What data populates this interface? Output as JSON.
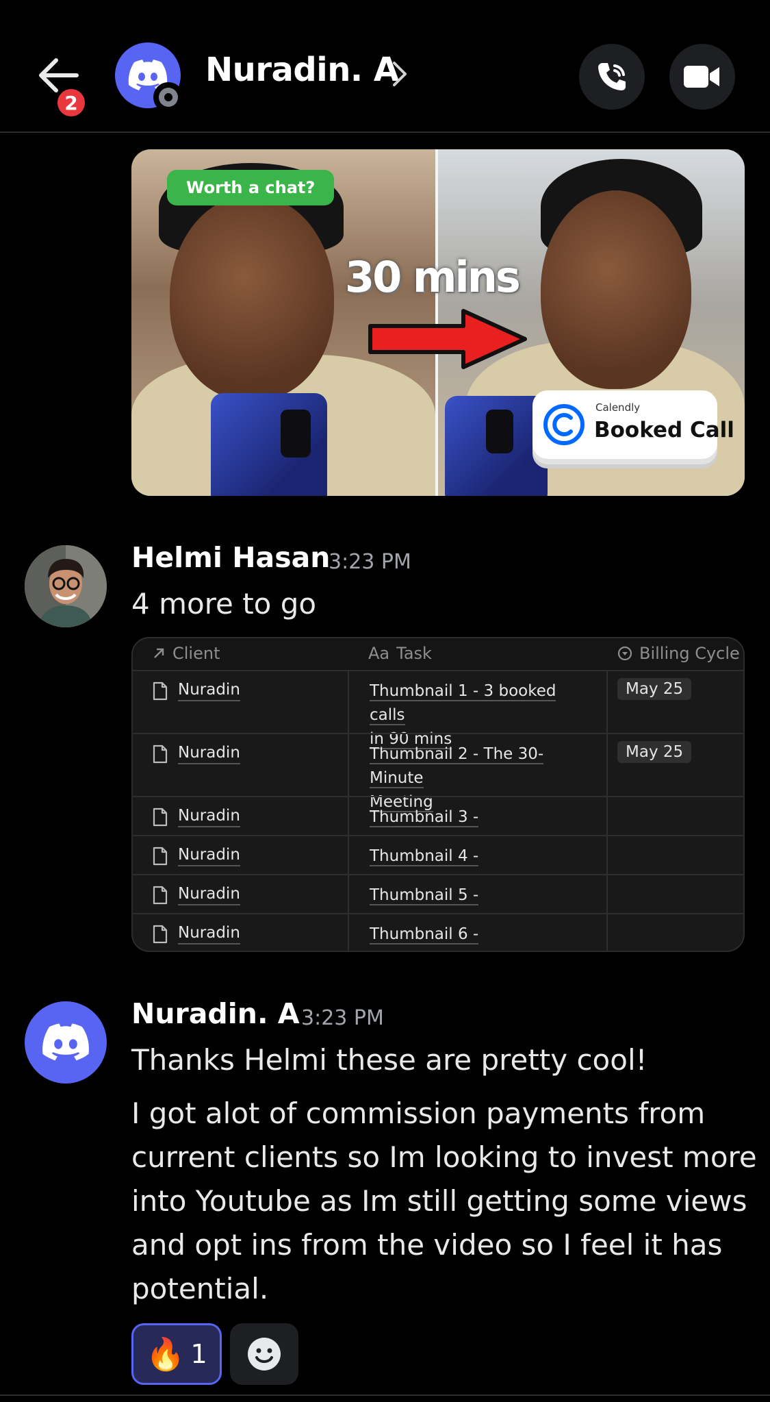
{
  "header": {
    "unread_count": "2",
    "contact_name": "Nuradin. A"
  },
  "thumbnail": {
    "tag_text": "Worth a chat?",
    "center_text": "30 mins",
    "card_brand": "Calendly",
    "card_title": "Booked Call"
  },
  "messages": [
    {
      "author": "Helmi Hasan",
      "time": "3:23 PM",
      "text": "4 more to go"
    },
    {
      "author": "Nuradin. A",
      "time": "3:23 PM",
      "text_line1": "Thanks Helmi these are pretty cool!",
      "paragraph": [
        "I got alot of commission payments from",
        "current clients so Im looking to invest more",
        "into Youtube as Im still getting some views",
        "and opt ins from the video so I feel it has",
        "potential."
      ]
    }
  ],
  "table": {
    "headers": [
      "Client",
      "Task",
      "Billing Cycle"
    ],
    "header_prefix_task": "Aa",
    "rows": [
      {
        "client": "Nuradin",
        "task_line1": "Thumbnail 1 - 3 booked calls",
        "task_line2": "in 90 mins",
        "billing": "May 25"
      },
      {
        "client": "Nuradin",
        "task_line1": "Thumbnail 2 - The 30-Minute",
        "task_line2": "Meeting",
        "billing": "May 25"
      },
      {
        "client": "Nuradin",
        "task_line1": "Thumbnail 3 -",
        "task_line2": "",
        "billing": ""
      },
      {
        "client": "Nuradin",
        "task_line1": "Thumbnail 4 -",
        "task_line2": "",
        "billing": ""
      },
      {
        "client": "Nuradin",
        "task_line1": "Thumbnail 5 -",
        "task_line2": "",
        "billing": ""
      },
      {
        "client": "Nuradin",
        "task_line1": "Thumbnail 6 -",
        "task_line2": "",
        "billing": ""
      }
    ]
  },
  "reactions": [
    {
      "emoji": "🔥",
      "count": "1"
    }
  ],
  "icons": {
    "back": "arrow-left-icon",
    "call": "phone-icon",
    "video": "video-camera-icon",
    "add_reaction": "smiley-face-icon",
    "doc": "document-icon"
  },
  "colors": {
    "discord_blurple": "#5865f2",
    "badge_red": "#e8383d",
    "reaction_border": "#5865f2"
  }
}
